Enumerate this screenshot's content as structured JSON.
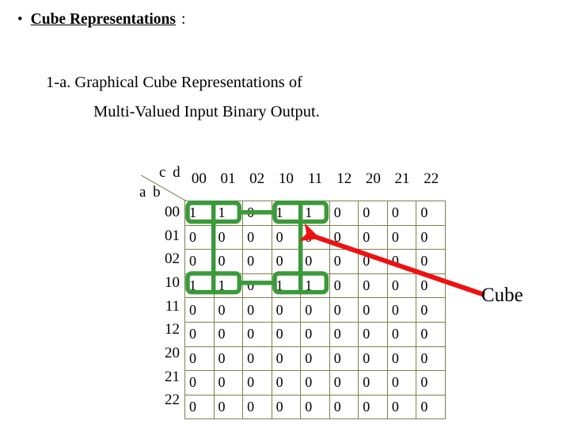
{
  "slide": {
    "bullet": {
      "marker": "•",
      "title": "Cube Representations",
      "colon": ":"
    },
    "subheading": {
      "line1": "1-a. Graphical Cube Representations of",
      "line2": "Multi-Valued Input Binary Output."
    },
    "axis": {
      "column_label": "c d",
      "row_label": "a b"
    },
    "annotation": {
      "cube_caption": "Cube",
      "arrow_color": "#ee1111",
      "cube_outline_color": "#3a9a3a"
    },
    "table": {
      "column_headers": [
        "00",
        "01",
        "02",
        "10",
        "11",
        "12",
        "20",
        "21",
        "22"
      ],
      "row_headers": [
        "00",
        "01",
        "02",
        "10",
        "11",
        "12",
        "20",
        "21",
        "22"
      ],
      "rows": [
        [
          "1",
          "1",
          "0",
          "1",
          "1",
          "0",
          "0",
          "0",
          "0"
        ],
        [
          "0",
          "0",
          "0",
          "0",
          "0",
          "0",
          "0",
          "0",
          "0"
        ],
        [
          "0",
          "0",
          "0",
          "0",
          "0",
          "0",
          "0",
          "0",
          "0"
        ],
        [
          "1",
          "1",
          "0",
          "1",
          "1",
          "0",
          "0",
          "0",
          "0"
        ],
        [
          "0",
          "0",
          "0",
          "0",
          "0",
          "0",
          "0",
          "0",
          "0"
        ],
        [
          "0",
          "0",
          "0",
          "0",
          "0",
          "0",
          "0",
          "0",
          "0"
        ],
        [
          "0",
          "0",
          "0",
          "0",
          "0",
          "0",
          "0",
          "0",
          "0"
        ],
        [
          "0",
          "0",
          "0",
          "0",
          "0",
          "0",
          "0",
          "0",
          "0"
        ],
        [
          "0",
          "0",
          "0",
          "0",
          "0",
          "0",
          "0",
          "0",
          "0"
        ]
      ]
    }
  }
}
